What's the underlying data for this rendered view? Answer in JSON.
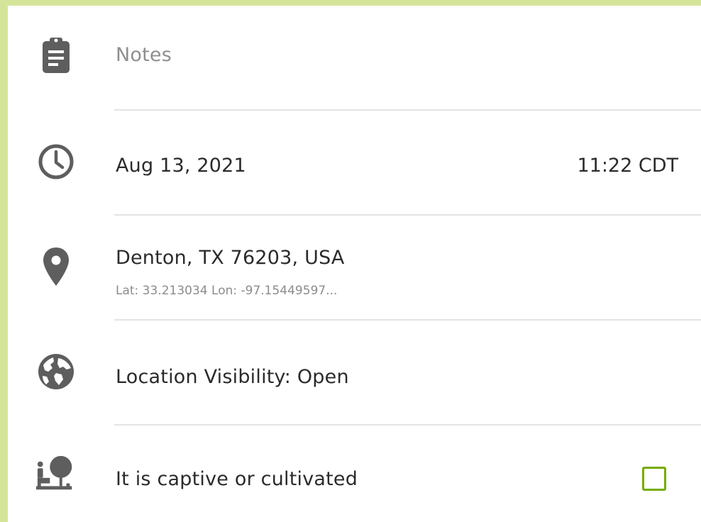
{
  "notes": {
    "placeholder": "Notes",
    "icon": "clipboard-icon"
  },
  "datetime": {
    "date": "Aug 13, 2021",
    "time": "11:22 CDT",
    "icon": "clock-icon"
  },
  "location": {
    "place": "Denton, TX 76203, USA",
    "coords": "Lat: 33.213034 Lon: -97.15449597...",
    "icon": "map-pin-icon"
  },
  "visibility": {
    "label": "Location Visibility: Open",
    "icon": "globe-icon"
  },
  "captive": {
    "label": "It is captive or cultivated",
    "checked": false,
    "icon": "captive-cultivated-icon"
  },
  "colors": {
    "background_frame": "#d4e59a",
    "checkbox_border": "#74ac00",
    "icon": "#5e5e5e"
  }
}
